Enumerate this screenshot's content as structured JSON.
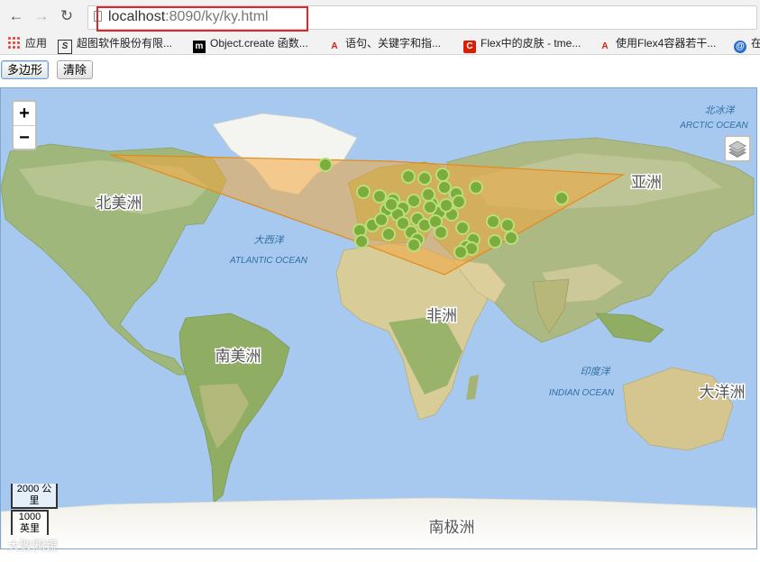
{
  "browser": {
    "url_host": "localhost",
    "url_path": ":8090/ky/ky.html",
    "back_icon": "back-arrow-icon",
    "forward_icon": "forward-arrow-icon",
    "reload_icon": "reload-icon",
    "bookmarks": [
      {
        "label": "应用",
        "icon": "apps-grid-icon"
      },
      {
        "label": "超图软件股份有限...",
        "icon": "supermap-icon"
      },
      {
        "label": "Object.create 函数...",
        "icon": "m-logo-icon"
      },
      {
        "label": "语句、关键字和指...",
        "icon": "adobe-icon"
      },
      {
        "label": "Flex中的皮肤 - tme...",
        "icon": "c-logo-icon"
      },
      {
        "label": "使用Flex4容器若干...",
        "icon": "adobe-icon"
      },
      {
        "label": "在",
        "icon": "globe-icon"
      }
    ]
  },
  "toolbar": {
    "polygon_label": "多边形",
    "clear_label": "清除"
  },
  "map": {
    "zoom_in": "+",
    "zoom_out": "−",
    "layers_icon": "layers-icon",
    "labels": {
      "north_america": "北美洲",
      "south_america": "南美洲",
      "africa": "非洲",
      "asia": "亚洲",
      "oceania": "大洋洲",
      "antarctica": "南极洲",
      "atlantic_cn": "大西洋",
      "atlantic_en": "ATLANTIC OCEAN",
      "indian_cn": "印度洋",
      "indian_en": "INDIAN OCEAN",
      "arctic_cn": "北冰洋",
      "arctic_en": "ARCTIC OCEAN"
    },
    "scale_metric_value": "2000",
    "scale_metric_unit_a": "公",
    "scale_metric_unit_b": "里",
    "scale_imperial_value": "1000",
    "scale_imperial_unit": "英里",
    "watermark": "大败鸦镜",
    "colors": {
      "ocean": "#a5c8f0",
      "polygon_fill": "#f2a63c",
      "polygon_stroke": "#e48a1a",
      "marker_fill": "#7cab3e",
      "marker_ring": "#b8e07a"
    }
  }
}
